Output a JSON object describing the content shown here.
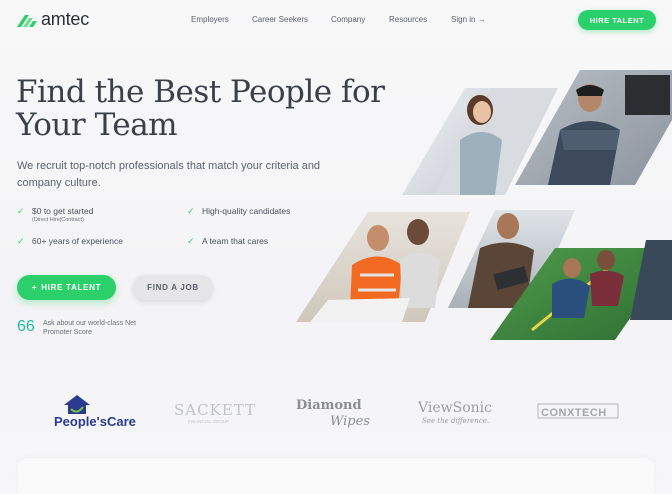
{
  "brand": {
    "name": "amtec",
    "accent": "#2bd06b",
    "score_color": "#22b9a6"
  },
  "nav": {
    "links": [
      "Employers",
      "Career Seekers",
      "Company",
      "Resources"
    ],
    "signin": "Sign in",
    "signin_icon": "arrow-right-icon",
    "cta": "HIRE TALENT"
  },
  "hero": {
    "title": "Find the Best People for Your Team",
    "subtitle": "We recruit top-notch professionals that match your criteria and company culture.",
    "features": [
      {
        "label": "$0 to get started",
        "sub": "(Direct Hire|Contract)"
      },
      {
        "label": "High-quality candidates",
        "sub": ""
      },
      {
        "label": "60+ years of experience",
        "sub": ""
      },
      {
        "label": "A team that cares",
        "sub": ""
      }
    ],
    "primary_cta": "HIRE TALENT",
    "primary_cta_icon": "plus-icon",
    "secondary_cta": "FIND A JOB",
    "nps_score": "66",
    "nps_label": "Ask about our world-class Net Promoter Score"
  },
  "logos": [
    {
      "name": "People's Care",
      "text": "People'sCare"
    },
    {
      "name": "Sackett",
      "text": "SACKETT",
      "sub": "FINANCIAL GROUP"
    },
    {
      "name": "Diamond Wipes",
      "text": "Diamond",
      "sub": "Wipes"
    },
    {
      "name": "ViewSonic",
      "text": "ViewSonic",
      "sub": "See the difference."
    },
    {
      "name": "ConXtech",
      "text": "CONXTECH"
    }
  ]
}
